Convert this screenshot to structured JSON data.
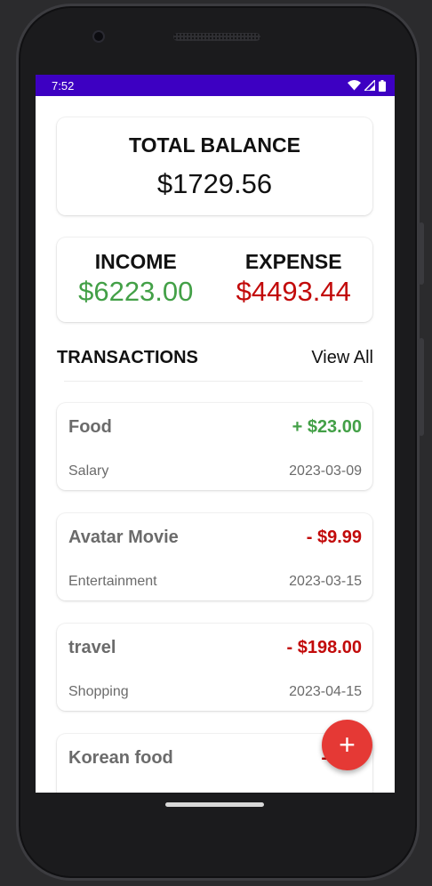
{
  "status_bar": {
    "time": "7:52"
  },
  "balance": {
    "title": "TOTAL BALANCE",
    "amount": "$1729.56"
  },
  "income": {
    "label": "INCOME",
    "value": "$6223.00"
  },
  "expense": {
    "label": "EXPENSE",
    "value": "$4493.44"
  },
  "transactions": {
    "title": "TRANSACTIONS",
    "view_all": "View All",
    "items": [
      {
        "name": "Food",
        "amount": "+ $23.00",
        "type": "income",
        "category": "Salary",
        "date": "2023-03-09"
      },
      {
        "name": "Avatar Movie",
        "amount": "- $9.99",
        "type": "expense",
        "category": "Entertainment",
        "date": "2023-03-15"
      },
      {
        "name": "travel",
        "amount": "- $198.00",
        "type": "expense",
        "category": "Shopping",
        "date": "2023-04-15"
      },
      {
        "name": "Korean food",
        "amount": "- $10",
        "type": "expense",
        "category": "",
        "date": ""
      }
    ]
  },
  "fab": {
    "label": "+"
  },
  "colors": {
    "status_bar": "#3d00c2",
    "income": "#43a047",
    "expense": "#c20a0a",
    "fab": "#e53935"
  },
  "icons": [
    "wifi-icon",
    "signal-icon",
    "battery-icon",
    "add-icon"
  ]
}
